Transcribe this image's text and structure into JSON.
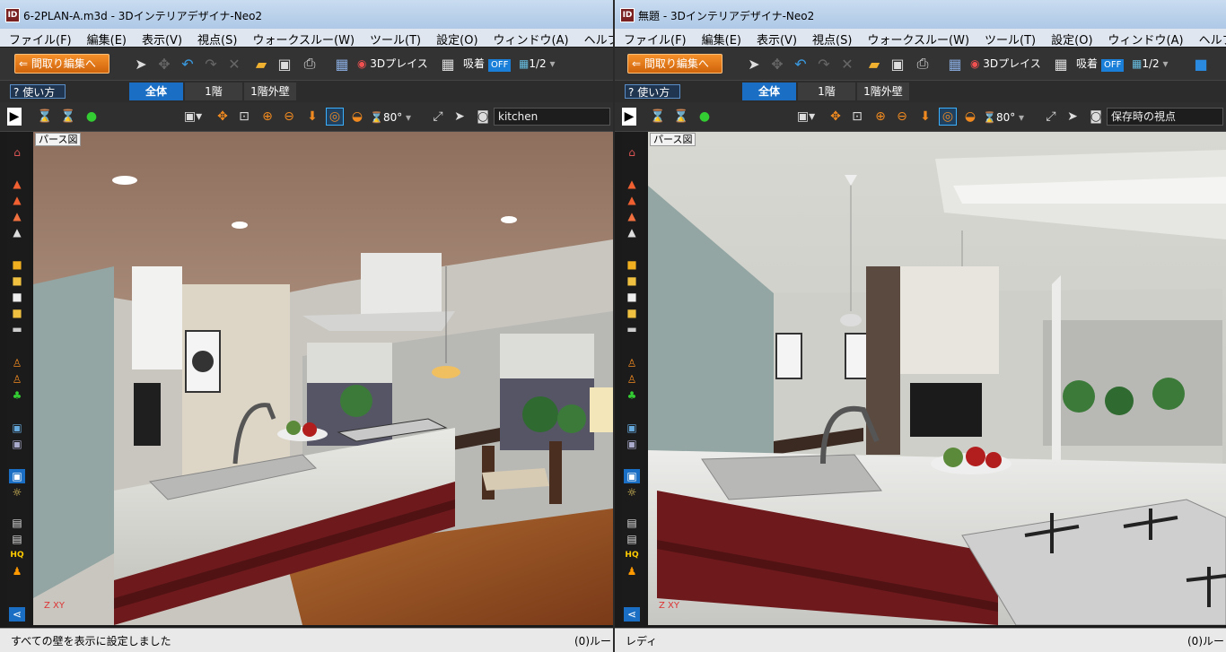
{
  "windows": [
    {
      "title": "6-2PLAN-A.m3d - 3Dインテリアデザイナ-Neo2",
      "menu": [
        "ファイル(F)",
        "編集(E)",
        "表示(V)",
        "視点(S)",
        "ウォークスルー(W)",
        "ツール(T)",
        "設定(O)",
        "ウィンドウ(A)",
        "ヘルプ(H)"
      ],
      "toolbar": {
        "floorplan_button": "間取り編集へ",
        "place3d_label": "3Dプレイス",
        "snap_label": "吸着",
        "snap_state": "OFF",
        "scale_label": "1/2"
      },
      "help_label": "使い方",
      "tabs": [
        "全体",
        "1階",
        "1階外壁"
      ],
      "active_tab": "全体",
      "view": {
        "angle": "80°",
        "viewpoint": "kitchen"
      },
      "view_label": "パース図",
      "axis_label": "Z XY",
      "status": "すべての壁を表示に設定しました",
      "status_right": "(0)ルー"
    },
    {
      "title": "無題 - 3Dインテリアデザイナ-Neo2",
      "menu": [
        "ファイル(F)",
        "編集(E)",
        "表示(V)",
        "視点(S)",
        "ウォークスルー(W)",
        "ツール(T)",
        "設定(O)",
        "ウィンドウ(A)",
        "ヘルプ(H)"
      ],
      "toolbar": {
        "floorplan_button": "間取り編集へ",
        "place3d_label": "3Dプレイス",
        "snap_label": "吸着",
        "snap_state": "OFF",
        "scale_label": "1/2"
      },
      "help_label": "使い方",
      "tabs": [
        "全体",
        "1階",
        "1階外壁"
      ],
      "active_tab": "全体",
      "view": {
        "angle": "80°",
        "viewpoint": "保存時の視点"
      },
      "view_label": "パース図",
      "axis_label": "Z XY",
      "status": "レディ",
      "status_right": "(0)ルー"
    }
  ],
  "colors": {
    "accent_orange": "#e8761a",
    "active_tab_blue": "#1a6fc4",
    "cabinet_red": "#6e1a1c",
    "floor_wood": "#9a5a2a"
  }
}
